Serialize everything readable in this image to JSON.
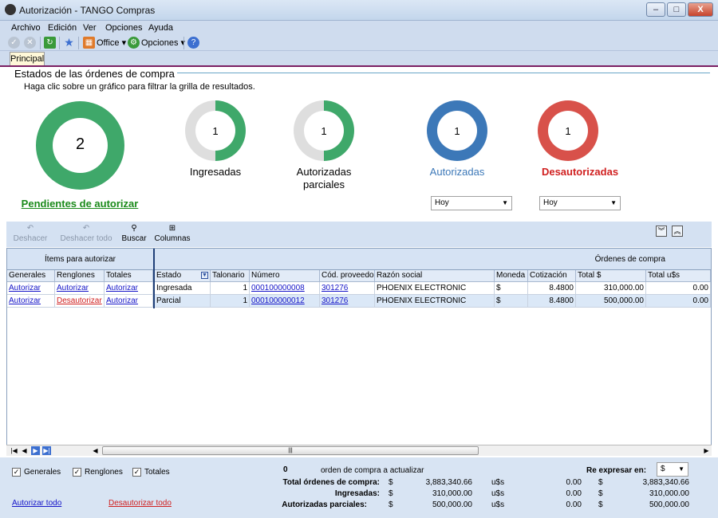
{
  "window": {
    "title": "Autorización - TANGO Compras",
    "min": "–",
    "max": "□",
    "close": "X"
  },
  "menu": [
    "Archivo",
    "Edición",
    "Ver",
    "Opciones",
    "Ayuda"
  ],
  "toolbar": {
    "office": "Office",
    "opciones": "Opciones"
  },
  "tabs": {
    "principal": "Principal"
  },
  "header": {
    "title": "Estados de las órdenes de compra",
    "hint": "Haga clic sobre un gráfico para filtrar la grilla de resultados."
  },
  "states": {
    "pendientes": {
      "count": "2",
      "label": "Pendientes de autorizar"
    },
    "ingresadas": {
      "count": "1",
      "label": "Ingresadas"
    },
    "autorizadas_parciales": {
      "count": "1",
      "label_line1": "Autorizadas",
      "label_line2": "parciales"
    },
    "autorizadas": {
      "count": "1",
      "label": "Autorizadas",
      "filter": "Hoy"
    },
    "desautorizadas": {
      "count": "1",
      "label": "Desautorizadas",
      "filter": "Hoy"
    }
  },
  "gridtoolbar": {
    "deshacer": "Deshacer",
    "deshacer_todo": "Deshacer todo",
    "buscar": "Buscar",
    "columnas": "Columnas"
  },
  "grid": {
    "group_left": "Ítems para autorizar",
    "group_right": "Órdenes de compra",
    "columns": [
      "Generales",
      "Renglones",
      "Totales",
      "Estado",
      "Talonario",
      "Número",
      "Cód. proveedor",
      "Razón social",
      "Moneda",
      "Cotización",
      "Total $",
      "Total u$s"
    ],
    "rows": [
      {
        "generales": "Autorizar",
        "renglones": "Autorizar",
        "totales": "Autorizar",
        "estado": "Ingresada",
        "talonario": "1",
        "numero": " 000100000008",
        "proveedor": "301276",
        "razon": "PHOENIX ELECTRONIC",
        "moneda": "$",
        "cotizacion": "8.4800",
        "total_pesos": "310,000.00",
        "total_usd": "0.00"
      },
      {
        "generales": "Autorizar",
        "renglones": "Desautorizar",
        "totales": "Autorizar",
        "estado": "Parcial",
        "talonario": "1",
        "numero": " 000100000012",
        "proveedor": "301276",
        "razon": "PHOENIX ELECTRONIC",
        "moneda": "$",
        "cotizacion": "8.4800",
        "total_pesos": "500,000.00",
        "total_usd": "0.00"
      }
    ]
  },
  "footer": {
    "checks": [
      "Generales",
      "Renglones",
      "Totales"
    ],
    "autorizar_todo": "Autorizar todo",
    "desautorizar_todo": "Desautorizar todo",
    "count": "0",
    "count_label": "orden de compra a actualizar",
    "reexpresar_label": "Re expresar en:",
    "reexpresar_value": "$",
    "totals": [
      {
        "label": "Total órdenes de compra:",
        "cur1": "$",
        "v1": "3,883,340.66",
        "cur2": "u$s",
        "v2": "0.00",
        "cur3": "$",
        "v3": "3,883,340.66"
      },
      {
        "label": "Ingresadas:",
        "cur1": "$",
        "v1": "310,000.00",
        "cur2": "u$s",
        "v2": "0.00",
        "cur3": "$",
        "v3": "310,000.00"
      },
      {
        "label": "Autorizadas parciales:",
        "cur1": "$",
        "v1": "500,000.00",
        "cur2": "u$s",
        "v2": "0.00",
        "cur3": "$",
        "v3": "500,000.00"
      }
    ]
  },
  "colors": {
    "green": "#3fa86a",
    "blue": "#3c78b8",
    "red": "#d8514a",
    "link": "#1515c8"
  }
}
